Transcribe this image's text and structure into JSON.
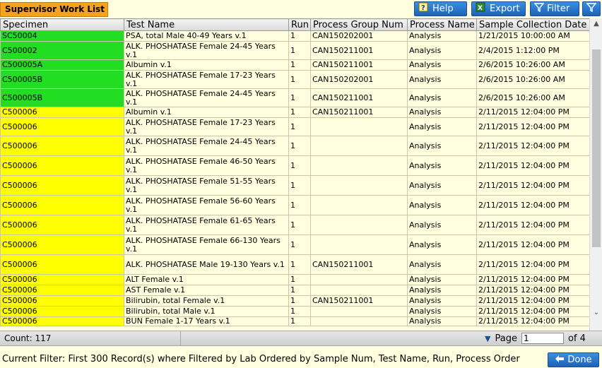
{
  "toolbar": {
    "title": "Supervisor Work List",
    "help_label": "Help",
    "export_label": "Export",
    "filter_label": "Filter"
  },
  "table": {
    "columns": [
      "Specimen",
      "Test Name",
      "Run",
      "Process Group Num",
      "Process Name",
      "Sample Collection Date"
    ],
    "rows": [
      {
        "specimen": "SC50004",
        "test": "PSA, total Male 40-49 Years v.1",
        "run": "1",
        "group": "CAN150202001",
        "process": "Analysis",
        "date": "1/21/2015 10:00:00 AM",
        "status": "green"
      },
      {
        "specimen": "C500002",
        "test": "ALK. PHOSHATASE Female 24-45 Years v.1",
        "run": "1",
        "group": "CAN150211001",
        "process": "Analysis",
        "date": "2/4/2015 1:12:00 PM",
        "status": "green"
      },
      {
        "specimen": "C500005A",
        "test": "Albumin v.1",
        "run": "1",
        "group": "CAN150211001",
        "process": "Analysis",
        "date": "2/6/2015 10:26:00 AM",
        "status": "green"
      },
      {
        "specimen": "C500005B",
        "test": "ALK. PHOSHATASE Female 17-23 Years v.1",
        "run": "1",
        "group": "CAN150202001",
        "process": "Analysis",
        "date": "2/6/2015 10:26:00 AM",
        "status": "green"
      },
      {
        "specimen": "C500005B",
        "test": "ALK. PHOSHATASE Female 24-45 Years v.1",
        "run": "1",
        "group": "CAN150211001",
        "process": "Analysis",
        "date": "2/6/2015 10:26:00 AM",
        "status": "green"
      },
      {
        "specimen": "C500006",
        "test": "Albumin v.1",
        "run": "1",
        "group": "CAN150211001",
        "process": "Analysis",
        "date": "2/11/2015 12:04:00 PM",
        "status": "yellow"
      },
      {
        "specimen": "C500006",
        "test": "ALK. PHOSHATASE Female 17-23 Years v.1",
        "run": "1",
        "group": "",
        "process": "Analysis",
        "date": "2/11/2015 12:04:00 PM",
        "status": "yellow"
      },
      {
        "specimen": "C500006",
        "test": "ALK. PHOSHATASE Female 24-45 Years v.1",
        "run": "1",
        "group": "",
        "process": "Analysis",
        "date": "2/11/2015 12:04:00 PM",
        "status": "yellow"
      },
      {
        "specimen": "C500006",
        "test": "ALK. PHOSHATASE Female 46-50 Years v.1",
        "run": "1",
        "group": "",
        "process": "Analysis",
        "date": "2/11/2015 12:04:00 PM",
        "status": "yellow"
      },
      {
        "specimen": "C500006",
        "test": "ALK. PHOSHATASE Female 51-55 Years v.1",
        "run": "1",
        "group": "",
        "process": "Analysis",
        "date": "2/11/2015 12:04:00 PM",
        "status": "yellow"
      },
      {
        "specimen": "C500006",
        "test": "ALK. PHOSHATASE Female 56-60 Years v.1",
        "run": "1",
        "group": "",
        "process": "Analysis",
        "date": "2/11/2015 12:04:00 PM",
        "status": "yellow"
      },
      {
        "specimen": "C500006",
        "test": "ALK. PHOSHATASE Female 61-65 Years v.1",
        "run": "1",
        "group": "",
        "process": "Analysis",
        "date": "2/11/2015 12:04:00 PM",
        "status": "yellow"
      },
      {
        "specimen": "C500006",
        "test": "ALK. PHOSHATASE Female 66-130 Years v.1",
        "run": "1",
        "group": "",
        "process": "Analysis",
        "date": "2/11/2015 12:04:00 PM",
        "status": "yellow"
      },
      {
        "specimen": "C500006",
        "test": "ALK. PHOSHATASE Male 19-130 Years v.1",
        "run": "1",
        "group": "CAN150211001",
        "process": "Analysis",
        "date": "2/11/2015 12:04:00 PM",
        "status": "yellow"
      },
      {
        "specimen": "C500006",
        "test": "ALT Female v.1",
        "run": "1",
        "group": "",
        "process": "Analysis",
        "date": "2/11/2015 12:04:00 PM",
        "status": "yellow"
      },
      {
        "specimen": "C500006",
        "test": "AST Female v.1",
        "run": "1",
        "group": "",
        "process": "Analysis",
        "date": "2/11/2015 12:04:00 PM",
        "status": "yellow"
      },
      {
        "specimen": "C500006",
        "test": "Bilirubin, total Female v.1",
        "run": "1",
        "group": "CAN150211001",
        "process": "Analysis",
        "date": "2/11/2015 12:04:00 PM",
        "status": "yellow"
      },
      {
        "specimen": "C500006",
        "test": "Bilirubin, total Male v.1",
        "run": "1",
        "group": "",
        "process": "Analysis",
        "date": "2/11/2015 12:04:00 PM",
        "status": "yellow"
      },
      {
        "specimen": "C500006",
        "test": "BUN Female 1-17 Years v.1",
        "run": "1",
        "group": "",
        "process": "Analysis",
        "date": "2/11/2015 12:04:00 PM",
        "status": "yellow"
      }
    ]
  },
  "footer": {
    "count_text": "Count: 117",
    "page_label": "Page",
    "page_value": "1",
    "page_total": "of 4"
  },
  "status_text": "Current Filter: First 300 Record(s) where Filtered by Lab Ordered by Sample Num, Test Name, Run, Process Order",
  "done_label": "Done",
  "colors": {
    "green": "#22dd22",
    "yellow": "#ffff00",
    "accent": "#1b62b8",
    "title_tab": "#f6a21c"
  }
}
